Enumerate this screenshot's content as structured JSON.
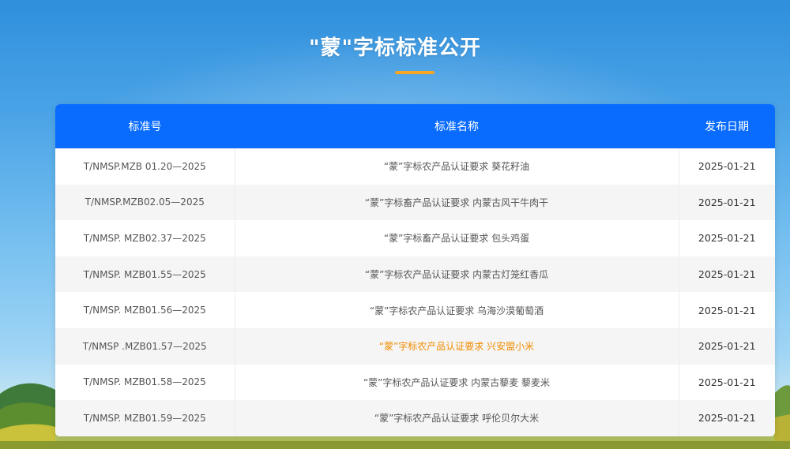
{
  "page": {
    "title": "\"蒙\"字标标准公开"
  },
  "colors": {
    "header_bg": "#0a6cff",
    "accent_underline": "#f5a623",
    "highlight_text": "#f08c00"
  },
  "table": {
    "headers": [
      "标准号",
      "标准名称",
      "发布日期"
    ],
    "rows": [
      {
        "code": "T/NMSP.MZB 01.20—2025",
        "name": "“蒙”字标农产品认证要求 葵花籽油",
        "date": "2025-01-21"
      },
      {
        "code": "T/NMSP.MZB02.05—2025",
        "name": "“蒙”字标畜产品认证要求 内蒙古风干牛肉干",
        "date": "2025-01-21"
      },
      {
        "code": "T/NMSP. MZB02.37—2025",
        "name": "“蒙”字标畜产品认证要求 包头鸡蛋",
        "date": "2025-01-21"
      },
      {
        "code": "T/NMSP. MZB01.55—2025",
        "name": "“蒙”字标农产品认证要求 内蒙古灯笼红香瓜",
        "date": "2025-01-21"
      },
      {
        "code": "T/NMSP. MZB01.56—2025",
        "name": "“蒙”字标农产品认证要求 乌海沙漠葡萄酒",
        "date": "2025-01-21"
      },
      {
        "code": "T/NMSP .MZB01.57—2025",
        "name": "“蒙”字标农产品认证要求 兴安盟小米",
        "date": "2025-01-21",
        "highlighted": true
      },
      {
        "code": "T/NMSP. MZB01.58—2025",
        "name": "“蒙”字标农产品认证要求 内蒙古藜麦 藜麦米",
        "date": "2025-01-21"
      },
      {
        "code": "T/NMSP. MZB01.59—2025",
        "name": "“蒙”字标农产品认证要求 呼伦贝尔大米",
        "date": "2025-01-21"
      }
    ]
  }
}
